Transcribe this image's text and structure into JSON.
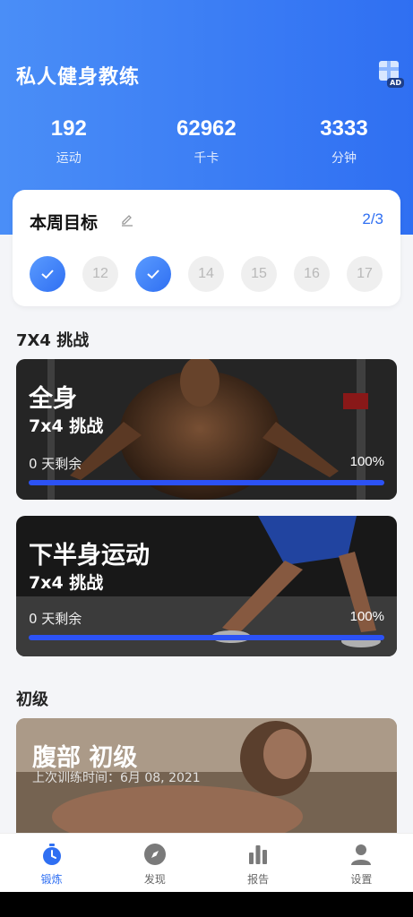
{
  "header": {
    "title": "私人健身教练",
    "ad_label": "AD",
    "stats": [
      {
        "value": "192",
        "label": "运动"
      },
      {
        "value": "62962",
        "label": "千卡"
      },
      {
        "value": "3333",
        "label": "分钟"
      }
    ]
  },
  "goal": {
    "title": "本周目标",
    "progress": "2/3",
    "days": [
      {
        "label": "",
        "done": true
      },
      {
        "label": "12",
        "done": false
      },
      {
        "label": "",
        "done": true
      },
      {
        "label": "14",
        "done": false
      },
      {
        "label": "15",
        "done": false
      },
      {
        "label": "16",
        "done": false
      },
      {
        "label": "17",
        "done": false
      }
    ]
  },
  "sections": {
    "challenge_title": "7X4 挑战",
    "beginner_title": "初级"
  },
  "cards": [
    {
      "title": "全身",
      "subtitle": "7x4 挑战",
      "remaining": "0 天剩余",
      "percent_text": "100%",
      "progress": 1.0
    },
    {
      "title": "下半身运动",
      "subtitle": "7x4 挑战",
      "remaining": "0 天剩余",
      "percent_text": "100%",
      "progress": 1.0
    },
    {
      "title": "腹部 初级",
      "last_trained": "上次训练时间：6月 08, 2021"
    }
  ],
  "nav": [
    {
      "label": "锻炼",
      "icon": "stopwatch-icon",
      "active": true
    },
    {
      "label": "发现",
      "icon": "compass-icon",
      "active": false
    },
    {
      "label": "报告",
      "icon": "bar-chart-icon",
      "active": false
    },
    {
      "label": "设置",
      "icon": "person-icon",
      "active": false
    }
  ],
  "colors": {
    "accent": "#2f6ff2",
    "progress_bar": "#2c52f5"
  }
}
